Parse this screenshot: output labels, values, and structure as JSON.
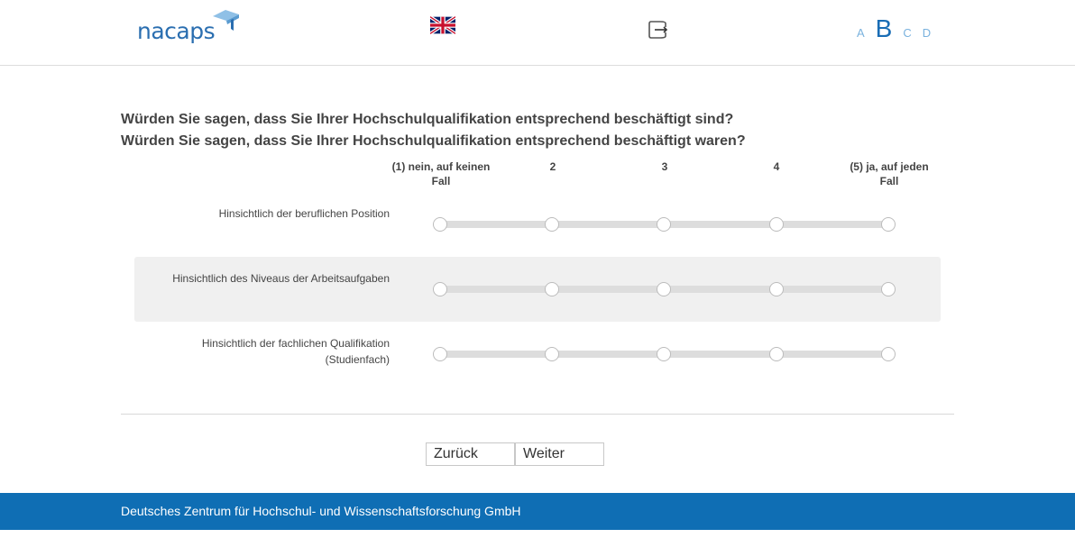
{
  "header": {
    "logo_text": "nacaps",
    "language_flag": "uk-flag-icon",
    "logout_icon": "logout-icon",
    "font_sizes": [
      "A",
      "B",
      "C",
      "D"
    ],
    "active_font_size": "B",
    "colors": {
      "brand": "#2a6eb0",
      "accent_light": "#7ab2de"
    }
  },
  "question": {
    "line1": "Würden Sie sagen, dass Sie Ihrer Hochschulqualifikation entsprechend beschäftigt sind?",
    "line2": "Würden Sie sagen, dass Sie Ihrer Hochschulqualifikation entsprechend beschäftigt waren?"
  },
  "scale": {
    "labels": [
      "(1) nein, auf keinen Fall",
      "2",
      "3",
      "4",
      "(5) ja, auf jeden Fall"
    ]
  },
  "items": [
    {
      "label": "Hinsichtlich der beruflichen Position",
      "selected": null
    },
    {
      "label": "Hinsichtlich des Niveaus der Arbeitsaufgaben",
      "selected": null
    },
    {
      "label": "Hinsichtlich der fachlichen Qualifikation (Studienfach)",
      "selected": null
    }
  ],
  "navigation": {
    "back_label": "Zurück",
    "next_label": "Weiter"
  },
  "footer": {
    "text": "Deutsches Zentrum für Hochschul- und Wissenschaftsforschung GmbH",
    "color": "#0f6eb4"
  }
}
